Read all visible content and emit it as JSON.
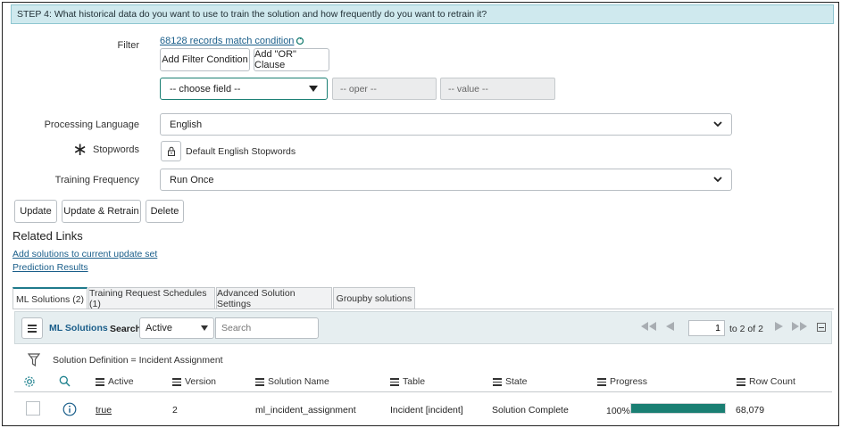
{
  "step": {
    "banner": "STEP 4: What historical data do you want to use to train the solution and how frequently do you want to retrain it?"
  },
  "filter": {
    "label": "Filter",
    "match_text": "68128 records match condition",
    "add_filter_label": "Add Filter Condition",
    "add_or_label": "Add \"OR\" Clause",
    "field_placeholder": "-- choose field --",
    "oper_placeholder": "-- oper --",
    "value_placeholder": "-- value --"
  },
  "processing_language": {
    "label": "Processing Language",
    "value": "English"
  },
  "stopwords": {
    "label": "Stopwords",
    "required_mark": "∗",
    "value": "Default English Stopwords"
  },
  "training_frequency": {
    "label": "Training Frequency",
    "value": "Run Once"
  },
  "actions": {
    "update": "Update",
    "update_retrain": "Update & Retrain",
    "delete": "Delete"
  },
  "related_links": {
    "title": "Related Links",
    "links": [
      "Add solutions to current update set",
      "Prediction Results"
    ]
  },
  "tabs": [
    {
      "label": "ML Solutions (2)",
      "active": true
    },
    {
      "label": "Training Request Schedules (1)",
      "active": false
    },
    {
      "label": "Advanced Solution Settings",
      "active": false
    },
    {
      "label": "Groupby solutions",
      "active": false
    }
  ],
  "list": {
    "title": "ML Solutions",
    "search_label": "Search",
    "search_field": "Active",
    "search_placeholder": "Search",
    "page_input": "1",
    "page_range": "to 2 of 2",
    "breadcrumb_filter": "Solution Definition = Incident Assignment",
    "columns": [
      "Active",
      "Version",
      "Solution Name",
      "Table",
      "State",
      "Progress",
      "Row Count"
    ],
    "rows": [
      {
        "active": "true",
        "version": "2",
        "solution_name": "ml_incident_assignment",
        "table": "Incident [incident]",
        "state": "Solution Complete",
        "progress_text": "100%",
        "progress": 1.0,
        "row_count": "68,079"
      }
    ]
  },
  "colors": {
    "banner_bg": "#cfe9ee",
    "accent": "#1f7a8c",
    "progress_fill": "#1a7f73",
    "link": "#1a5e8a"
  }
}
